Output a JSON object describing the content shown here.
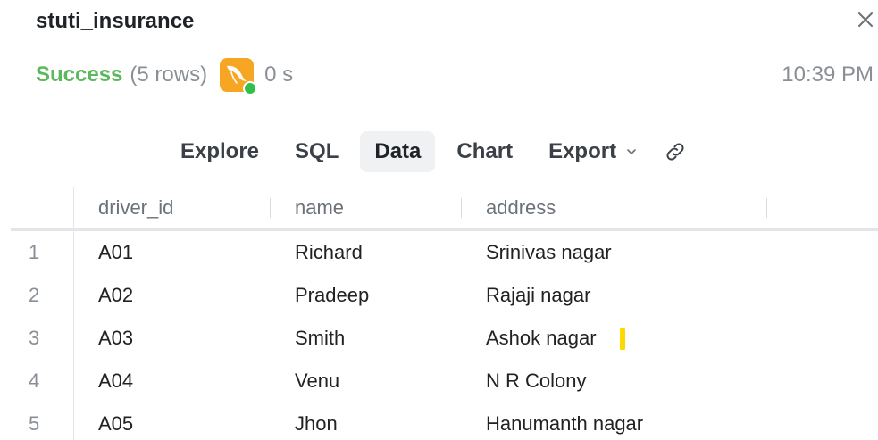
{
  "header": {
    "title": "stuti_insurance",
    "close_icon": "close-icon"
  },
  "status": {
    "state": "Success",
    "rows": "(5 rows)",
    "db_icon": "mysql-dolphin-icon",
    "duration": "0 s",
    "time": "10:39 PM"
  },
  "tabs": [
    {
      "label": "Explore",
      "active": false
    },
    {
      "label": "SQL",
      "active": false
    },
    {
      "label": "Data",
      "active": true
    },
    {
      "label": "Chart",
      "active": false
    },
    {
      "label": "Export",
      "active": false
    }
  ],
  "tab_icons": {
    "export_dropdown": "chevron-down-icon",
    "share": "link-icon"
  },
  "table": {
    "columns": [
      "driver_id",
      "name",
      "address"
    ],
    "rows": [
      {
        "num": "1",
        "driver_id": "A01",
        "name": "Richard",
        "address": "Srinivas nagar"
      },
      {
        "num": "2",
        "driver_id": "A02",
        "name": "Pradeep",
        "address": "Rajaji nagar"
      },
      {
        "num": "3",
        "driver_id": "A03",
        "name": "Smith",
        "address": "Ashok nagar"
      },
      {
        "num": "4",
        "driver_id": "A04",
        "name": "Venu",
        "address": "N R Colony"
      },
      {
        "num": "5",
        "driver_id": "A05",
        "name": "Jhon",
        "address": "Hanumanth nagar"
      }
    ]
  },
  "colors": {
    "success": "#5cb85c",
    "db_icon_bg": "#f6a623",
    "online_dot": "#2fbf4a",
    "cursor_highlight": "#ffd800"
  }
}
